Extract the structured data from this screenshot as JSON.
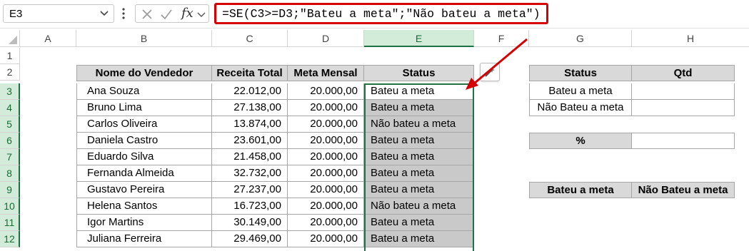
{
  "name_box": {
    "value": "E3"
  },
  "formula_bar": {
    "fx_label": "fx",
    "formula": "=SE(C3>=D3;\"Bateu a meta\";\"Não bateu a meta\")"
  },
  "columns": [
    "A",
    "B",
    "C",
    "D",
    "E",
    "F",
    "G",
    "H"
  ],
  "rows": [
    "1",
    "2",
    "3",
    "4",
    "5",
    "6",
    "7",
    "8",
    "9",
    "10",
    "11",
    "12"
  ],
  "table": {
    "headers": [
      "Nome do Vendedor",
      "Receita Total",
      "Meta Mensal",
      "Status"
    ],
    "rows": [
      {
        "nome": "Ana Souza",
        "receita": "22.012,00",
        "meta": "20.000,00",
        "status": "Bateu a meta"
      },
      {
        "nome": "Bruno Lima",
        "receita": "27.138,00",
        "meta": "20.000,00",
        "status": "Bateu a meta"
      },
      {
        "nome": "Carlos Oliveira",
        "receita": "13.874,00",
        "meta": "20.000,00",
        "status": "Não bateu a meta"
      },
      {
        "nome": "Daniela Castro",
        "receita": "23.601,00",
        "meta": "20.000,00",
        "status": "Bateu a meta"
      },
      {
        "nome": "Eduardo Silva",
        "receita": "21.458,00",
        "meta": "20.000,00",
        "status": "Bateu a meta"
      },
      {
        "nome": "Fernanda Almeida",
        "receita": "32.732,00",
        "meta": "20.000,00",
        "status": "Bateu a meta"
      },
      {
        "nome": "Gustavo Pereira",
        "receita": "27.237,00",
        "meta": "20.000,00",
        "status": "Bateu a meta"
      },
      {
        "nome": "Helena Santos",
        "receita": "16.723,00",
        "meta": "20.000,00",
        "status": "Não bateu a meta"
      },
      {
        "nome": "Igor Martins",
        "receita": "30.149,00",
        "meta": "20.000,00",
        "status": "Bateu a meta"
      },
      {
        "nome": "Juliana Ferreira",
        "receita": "29.469,00",
        "meta": "20.000,00",
        "status": "Bateu a meta"
      }
    ]
  },
  "summary": {
    "headers": [
      "Status",
      "Qtd"
    ],
    "rows": [
      {
        "label": "Bateu a meta",
        "value": ""
      },
      {
        "label": "Não Bateu a meta",
        "value": ""
      }
    ],
    "percent_label": "%",
    "percent_value": "",
    "bottom_headers": [
      "Bateu a meta",
      "Não Bateu a meta"
    ]
  },
  "colors": {
    "accent": "#217346",
    "formula_highlight": "#d60000",
    "header_fill": "#d9d9d9",
    "selection_fill": "#c9c9c9"
  },
  "icons": [
    "chevron-down-icon",
    "more-options-icon",
    "cancel-icon",
    "confirm-icon",
    "fx-icon",
    "quick-analysis-icon",
    "annotation-arrow"
  ]
}
